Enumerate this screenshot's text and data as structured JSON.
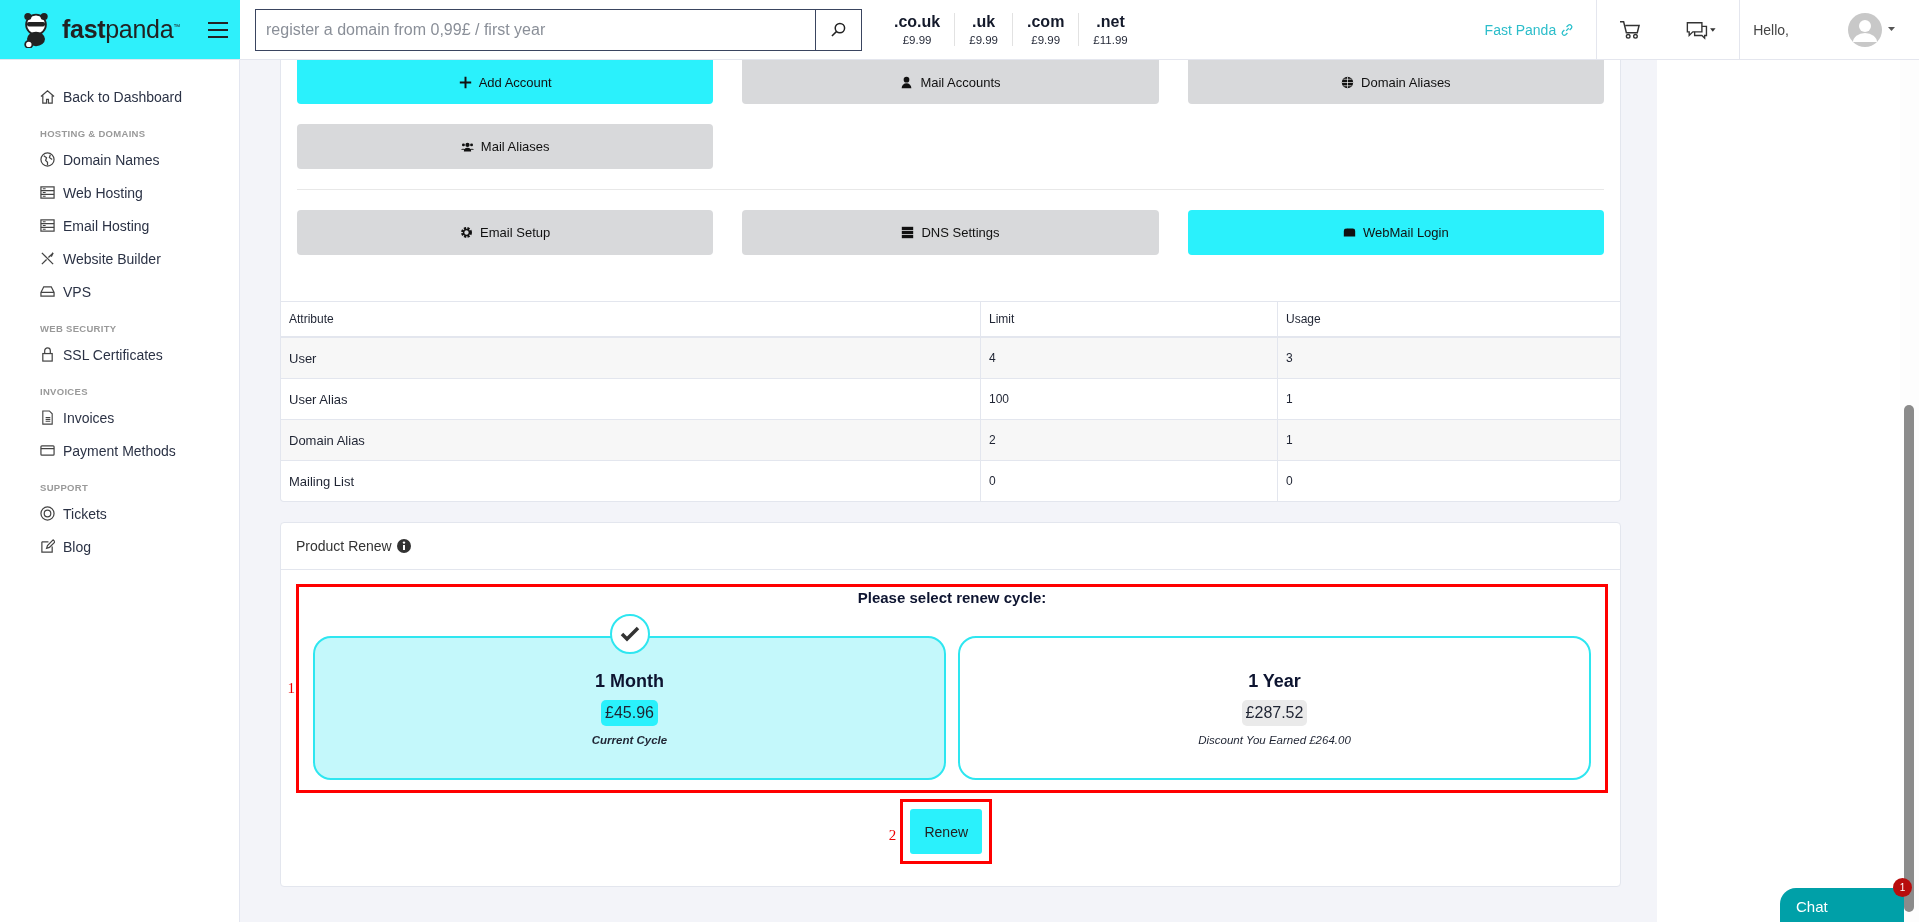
{
  "brand": {
    "name_bold": "fast",
    "name_light": "panda",
    "trademark": "™"
  },
  "search": {
    "placeholder": "register a domain from 0,99£ / first year"
  },
  "domain_prices": [
    {
      "tld": ".co.uk",
      "price": "£9.99"
    },
    {
      "tld": ".uk",
      "price": "£9.99"
    },
    {
      "tld": ".com",
      "price": "£9.99"
    },
    {
      "tld": ".net",
      "price": "£11.99"
    }
  ],
  "header_link": "Fast Panda",
  "greeting": "Hello,",
  "sidebar": [
    {
      "items": [
        "Back to Dashboard"
      ]
    },
    {
      "heading": "HOSTING & DOMAINS",
      "items": [
        "Domain Names",
        "Web Hosting",
        "Email Hosting",
        "Website Builder",
        "VPS"
      ]
    },
    {
      "heading": "WEB SECURITY",
      "items": [
        "SSL Certificates"
      ]
    },
    {
      "heading": "INVOICES",
      "items": [
        "Invoices",
        "Payment Methods"
      ]
    },
    {
      "heading": "SUPPORT",
      "items": [
        "Tickets",
        "Blog"
      ]
    }
  ],
  "action_rows": [
    [
      {
        "label": "Add Account",
        "kind": "primary"
      },
      {
        "label": "Mail Accounts",
        "kind": "secondary"
      },
      {
        "label": "Domain Aliases",
        "kind": "secondary"
      },
      {
        "label": "Mail Aliases",
        "kind": "secondary"
      }
    ],
    [
      {
        "label": "Email Setup",
        "kind": "secondary"
      },
      {
        "label": "DNS Settings",
        "kind": "secondary"
      },
      {
        "label": "WebMail Login",
        "kind": "primary"
      }
    ]
  ],
  "table": {
    "columns": [
      "Attribute",
      "Limit",
      "Usage"
    ],
    "rows": [
      [
        "User",
        "4",
        "3"
      ],
      [
        "User Alias",
        "100",
        "1"
      ],
      [
        "Domain Alias",
        "2",
        "1"
      ],
      [
        "Mailing List",
        "0",
        "0"
      ]
    ]
  },
  "renew": {
    "title": "Product Renew",
    "prompt": "Please select renew cycle:",
    "options": [
      {
        "name": "1 Month",
        "price": "£45.96",
        "note": "Current Cycle",
        "selected": true
      },
      {
        "name": "1 Year",
        "price": "£287.52",
        "note": "Discount You Earned £264.00",
        "selected": false
      }
    ],
    "button": "Renew"
  },
  "annotations": [
    "1",
    "2"
  ],
  "chat": {
    "label": "Chat",
    "badge": "1"
  }
}
